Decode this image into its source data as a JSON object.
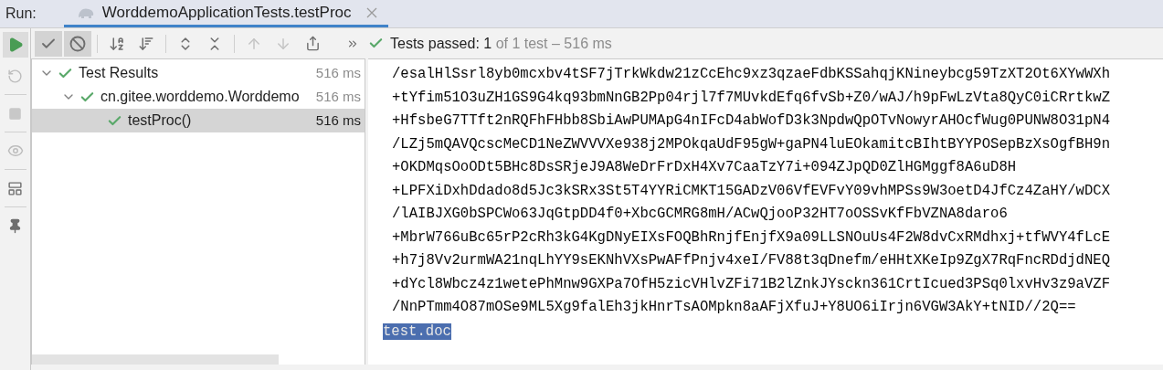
{
  "run_label": "Run:",
  "tabs": [
    {
      "label": "WorddemoApplicationTests.testProc",
      "selected": true
    }
  ],
  "toolbar_toggles": [
    {
      "kind": "passed",
      "selected": true
    },
    {
      "kind": "ignored",
      "selected": true
    }
  ],
  "status": {
    "bold": "Tests passed: 1",
    "rest": "of 1 test – 516 ms"
  },
  "tree": [
    {
      "label": "Test Results",
      "time": "516 ms",
      "expanded": true,
      "selected": false,
      "children": [
        {
          "label": "cn.gitee.worddemo.Worddemo",
          "time": "516 ms",
          "expanded": true,
          "selected": false,
          "children": [
            {
              "label": "testProc()",
              "time": "516 ms",
              "selected": true
            }
          ]
        }
      ]
    }
  ],
  "console_lines": [
    "/esalHlSsrl8yb0mcxbv4tSF7jTrkWkdw21zCcEhc9xz3qzaeFdbKSSahqjKNineybcg59TzXT2Ot6XYwWXh",
    "+tYfim51O3uZH1GS9G4kq93bmNnGB2Pp04rjl7f7MUvkdEfq6fvSb+Z0/wAJ/h9pFwLzVta8QyC0iCRrtkwZ",
    "+HfsbeG7TTft2nRQFhFHbb8SbiAwPUMApG4nIFcD4abWofD3k3NpdwQpOTvNowyrAHOcfWug0PUNW8O31pN4",
    "/LZj5mQAVQcscMeCD1NeZWVVVXe938j2MPOkqaUdF95gW+gaPN4luEOkamitcBIhtBYYPOSepBzXsOgfBH9n",
    "+OKDMqsOoODt5BHc8DsSRjeJ9A8WeDrFrDxH4Xv7CaaTzY7i+094ZJpQD0ZlHGMggf8A6uD8H",
    "+LPFXiDxhDdado8d5Jc3kSRx3St5T4YYRiCMKT15GADzV06VfEVFvY09vhMPSs9W3oetD4JfCz4ZaHY/wDCX",
    "/lAIBJXG0bSPCWo63JqGtpDD4f0+XbcGCMRG8mH/ACwQjooP32HT7oOSSvKfFbVZNA8daro6",
    "+MbrW766uBc65rP2cRh3kG4KgDNyEIXsFOQBhRnjfEnjfX9a09LLSNOuUs4F2W8dvCxRMdhxj+tfWVY4fLcE",
    "+h7j8Vv2urmWA21nqLhYY9sEKNhVXsPwAFfPnjv4xeI/FV88t3qDnefm/eHHtXKeIp9ZgX7RqFncRDdjdNEQ",
    "+dYcl8Wbcz4z1wetePhMnw9GXPa7OfH5zicVHlvZFi71B2lZnkJYsckn361CrtIcued3PSq0lxvHv3z9aVZF",
    "/NnPTmm4O87mOSe9ML5Xg9falEh3jkHnrTsAOMpkn8aAFjXfuJ+Y8UO6iIrjn6VGW3AkY+tNID//2Q=="
  ],
  "output": {
    "text": "test.doc",
    "selected": true
  }
}
